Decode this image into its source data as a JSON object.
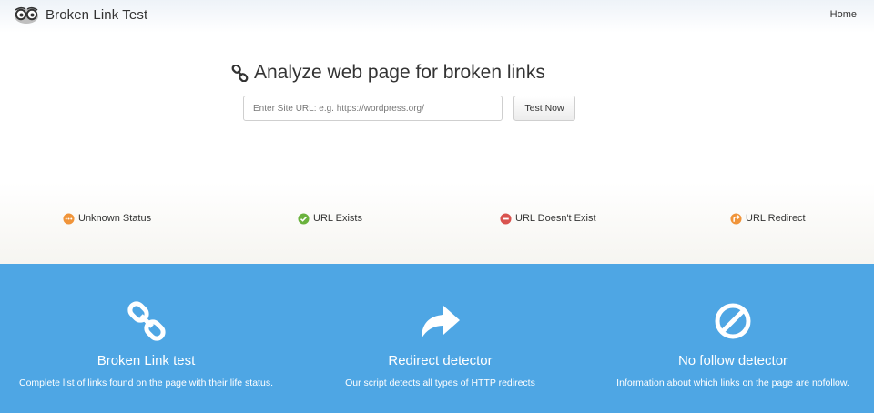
{
  "header": {
    "brand": "Broken Link Test",
    "nav_home": "Home"
  },
  "hero": {
    "title": "Analyze web page for broken links",
    "input_placeholder": "Enter Site URL: e.g. https://wordpress.org/",
    "input_value": "",
    "button_label": "Test Now"
  },
  "legend": [
    {
      "label": "Unknown Status",
      "icon": "ellipsis-circle-icon",
      "color": "#f0943a"
    },
    {
      "label": "URL Exists",
      "icon": "check-circle-icon",
      "color": "#6ab23d"
    },
    {
      "label": "URL Doesn't Exist",
      "icon": "minus-circle-icon",
      "color": "#d9534f"
    },
    {
      "label": "URL Redirect",
      "icon": "redirect-circle-icon",
      "color": "#f0943a"
    }
  ],
  "features": [
    {
      "title": "Broken Link test",
      "description": "Complete list of links found on the page with their life status.",
      "icon": "link-icon"
    },
    {
      "title": "Redirect detector",
      "description": "Our script detects all types of HTTP redirects",
      "icon": "share-arrow-icon"
    },
    {
      "title": "No follow detector",
      "description": "Information about which links on the page are nofollow.",
      "icon": "ban-icon"
    }
  ],
  "colors": {
    "band": "#4ea6e4",
    "text": "#333333"
  }
}
